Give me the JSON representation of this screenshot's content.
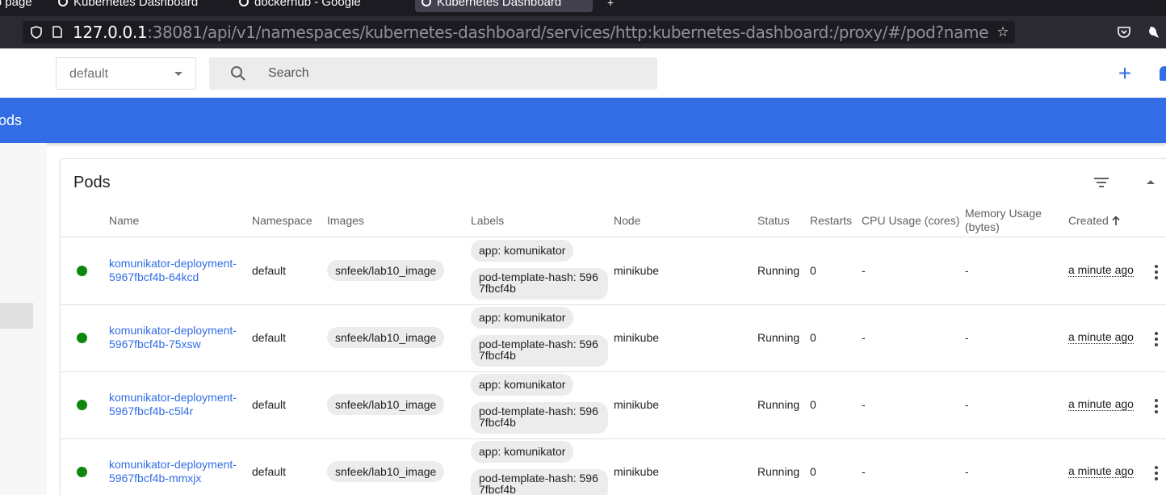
{
  "browser": {
    "tabs": [
      {
        "label": "New Tab page"
      },
      {
        "label": "Kubernetes Dashboard"
      },
      {
        "label": "dockerhub - Google"
      },
      {
        "label": "Kubernetes Dashboard"
      }
    ],
    "url": {
      "host": "127.0.0.1",
      "rest": ":38081/api/v1/namespaces/kubernetes-dashboard/services/http:kubernetes-dashboard:/proxy/#/pod?namespace=default"
    }
  },
  "toolbar": {
    "namespace": "default",
    "search_placeholder": "Search"
  },
  "titlebar": {
    "title": "Pods"
  },
  "card": {
    "title": "Pods",
    "columns": {
      "name": "Name",
      "namespace": "Namespace",
      "images": "Images",
      "labels": "Labels",
      "node": "Node",
      "status": "Status",
      "restarts": "Restarts",
      "cpu": "CPU Usage (cores)",
      "memory_line1": "Memory Usage",
      "memory_line2": "(bytes)",
      "created": "Created"
    },
    "rows": [
      {
        "name": "komunikator-deployment-5967fbcf4b-64kcd",
        "namespace": "default",
        "image": "snfeek/lab10_image",
        "label1": "app: komunikator",
        "label2": "pod-template-hash: 5967fbcf4b",
        "node": "minikube",
        "status": "Running",
        "restarts": "0",
        "cpu": "-",
        "memory": "-",
        "created": "a minute ago"
      },
      {
        "name": "komunikator-deployment-5967fbcf4b-75xsw",
        "namespace": "default",
        "image": "snfeek/lab10_image",
        "label1": "app: komunikator",
        "label2": "pod-template-hash: 5967fbcf4b",
        "node": "minikube",
        "status": "Running",
        "restarts": "0",
        "cpu": "-",
        "memory": "-",
        "created": "a minute ago"
      },
      {
        "name": "komunikator-deployment-5967fbcf4b-c5l4r",
        "namespace": "default",
        "image": "snfeek/lab10_image",
        "label1": "app: komunikator",
        "label2": "pod-template-hash: 5967fbcf4b",
        "node": "minikube",
        "status": "Running",
        "restarts": "0",
        "cpu": "-",
        "memory": "-",
        "created": "a minute ago"
      },
      {
        "name": "komunikator-deployment-5967fbcf4b-mmxjx",
        "namespace": "default",
        "image": "snfeek/lab10_image",
        "label1": "app: komunikator",
        "label2": "pod-template-hash: 5967fbcf4b",
        "node": "minikube",
        "status": "Running",
        "restarts": "0",
        "cpu": "-",
        "memory": "-",
        "created": "a minute ago"
      }
    ]
  },
  "colors": {
    "accent": "#326de6",
    "status_running": "#0c880c"
  }
}
